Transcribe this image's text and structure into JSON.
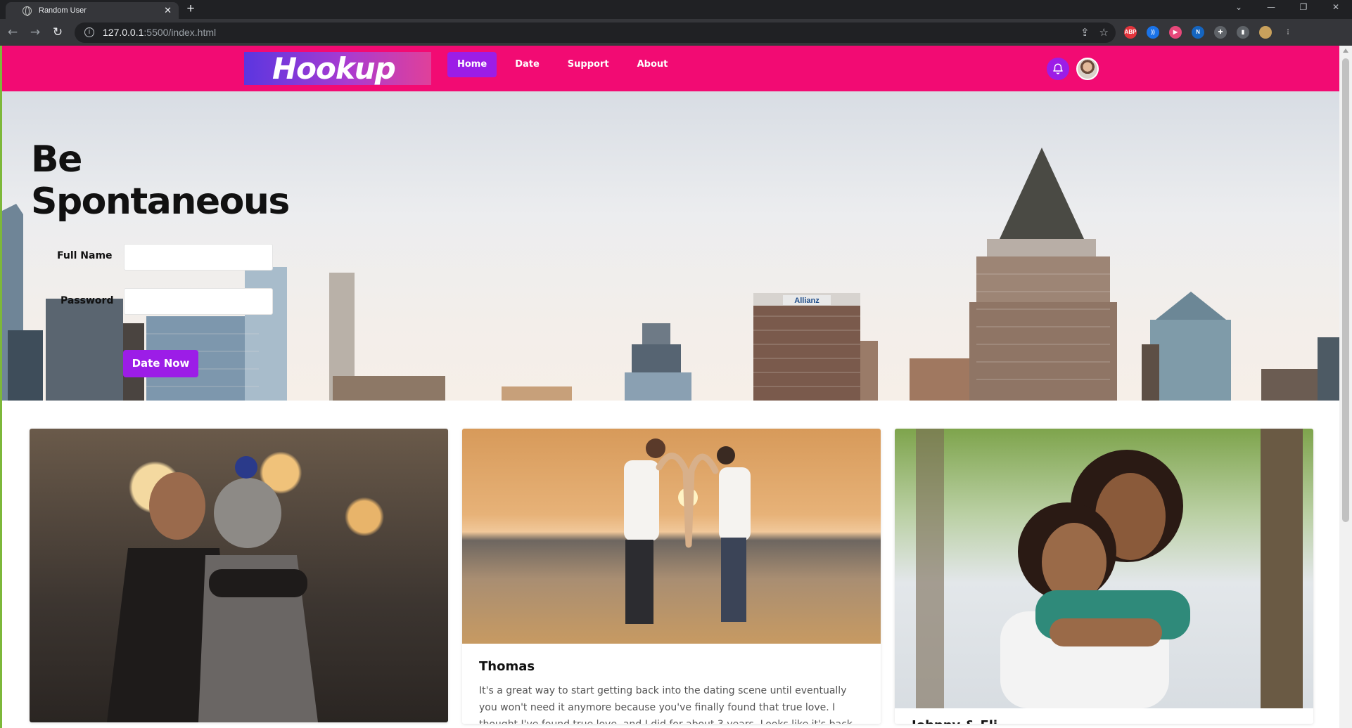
{
  "browser": {
    "tab_title": "Random User",
    "tab_close": "✕",
    "new_tab": "+",
    "url_host": "127.0.0.1",
    "url_path": ":5500/index.html",
    "window_controls": [
      "⌄",
      "—",
      "❐",
      "✕"
    ],
    "extensions": [
      {
        "name": "abp-icon",
        "label": "ABP",
        "color": "#e4343c"
      },
      {
        "name": "audio-icon",
        "label": "))",
        "color": "#1a73e8"
      },
      {
        "name": "record-icon",
        "label": "▶",
        "color": "#e8487a"
      },
      {
        "name": "n-extension-icon",
        "label": "N",
        "color": "#1565c0"
      },
      {
        "name": "puzzle-icon",
        "label": "✚",
        "color": "#5f6368"
      },
      {
        "name": "sidepanel-icon",
        "label": "▮",
        "color": "#5f6368"
      },
      {
        "name": "profile-icon",
        "label": "",
        "color": "#c9a15c"
      },
      {
        "name": "menu-icon",
        "label": "⋮",
        "color": "#35363a"
      }
    ]
  },
  "nav": {
    "logo": "Hookup",
    "links": [
      {
        "label": "Home",
        "active": true
      },
      {
        "label": "Date",
        "active": false
      },
      {
        "label": "Support",
        "active": false
      },
      {
        "label": "About",
        "active": false
      }
    ],
    "accent": "#f20b73",
    "active_color": "#9c1de7"
  },
  "hero": {
    "title_line1": "Be",
    "title_line2": "Spontaneous",
    "fullname_label": "Full Name",
    "password_label": "Password",
    "fullname_value": "",
    "password_value": "",
    "button_label": "Date Now",
    "building_sign": "Allianz"
  },
  "cards": [
    {
      "title": "",
      "text": ""
    },
    {
      "title": "Thomas",
      "text": "It's a great way to start getting back into the dating scene until eventually you won't need it anymore because you've finally found that true love. I thought I've found true love, and I did for about 3 years. Looks like it's back"
    },
    {
      "title": "Johnny & Eli",
      "text": ""
    }
  ]
}
